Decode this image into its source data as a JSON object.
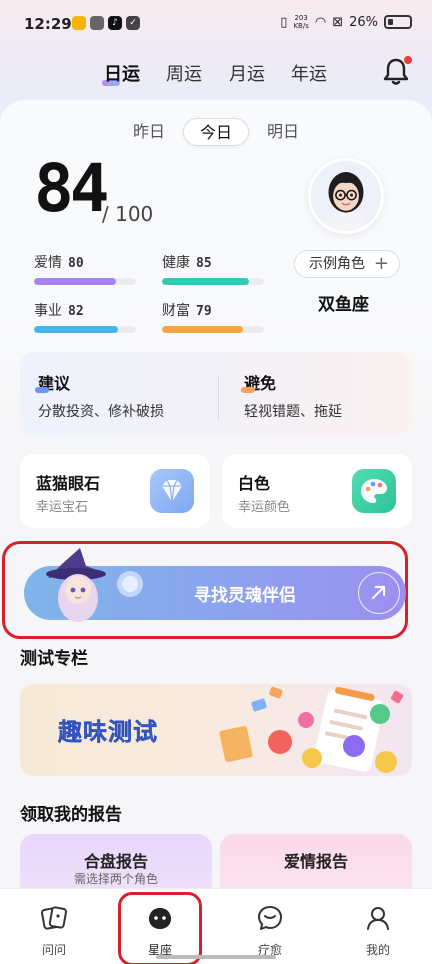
{
  "status_bar": {
    "time": "12:29",
    "net_speed": "203\nKB/s",
    "battery": "26%"
  },
  "top_tabs": [
    {
      "label": "日运",
      "active": true
    },
    {
      "label": "周运",
      "active": false
    },
    {
      "label": "月运",
      "active": false
    },
    {
      "label": "年运",
      "active": false
    }
  ],
  "day_tabs": [
    {
      "label": "昨日",
      "active": false
    },
    {
      "label": "今日",
      "active": true
    },
    {
      "label": "明日",
      "active": false
    }
  ],
  "score": {
    "value": "84",
    "max": "/ 100"
  },
  "metrics": [
    {
      "label": "爱情",
      "value": "80",
      "level": 0.8,
      "color": "#a683f0"
    },
    {
      "label": "健康",
      "value": "85",
      "level": 0.85,
      "color": "#34ccb1"
    },
    {
      "label": "事业",
      "value": "82",
      "level": 0.82,
      "color": "#46b6f0"
    },
    {
      "label": "财富",
      "value": "79",
      "level": 0.79,
      "color": "#f5a445"
    }
  ],
  "profile": {
    "role_button": "示例角色",
    "zodiac": "双鱼座"
  },
  "advice": {
    "do_title": "建议",
    "do_text": "分散投资、修补破损",
    "avoid_title": "避免",
    "avoid_text": "轻视错题、拖延"
  },
  "lucky": [
    {
      "name": "蓝猫眼石",
      "sub": "幸运宝石",
      "icon": "diamond-icon",
      "color": "#8fb6f5"
    },
    {
      "name": "白色",
      "sub": "幸运颜色",
      "icon": "palette-icon",
      "color": "#3bd1a2"
    }
  ],
  "soul_banner": {
    "label": "寻找灵魂伴侣"
  },
  "test_section": {
    "title": "测试专栏",
    "banner_text": "趣味测试"
  },
  "report_section": {
    "title": "领取我的报告",
    "cards": [
      {
        "name": "合盘报告",
        "sub": "需选择两个角色",
        "color": "#ead9fb"
      },
      {
        "name": "爱情报告",
        "sub": "",
        "color": "#fbdcec"
      }
    ]
  },
  "bottom_nav": [
    {
      "label": "问问",
      "icon": "cards-icon",
      "active": false
    },
    {
      "label": "星座",
      "icon": "constellation-icon",
      "active": true
    },
    {
      "label": "疗愈",
      "icon": "chat-heal-icon",
      "active": false
    },
    {
      "label": "我的",
      "icon": "profile-icon",
      "active": false
    }
  ]
}
